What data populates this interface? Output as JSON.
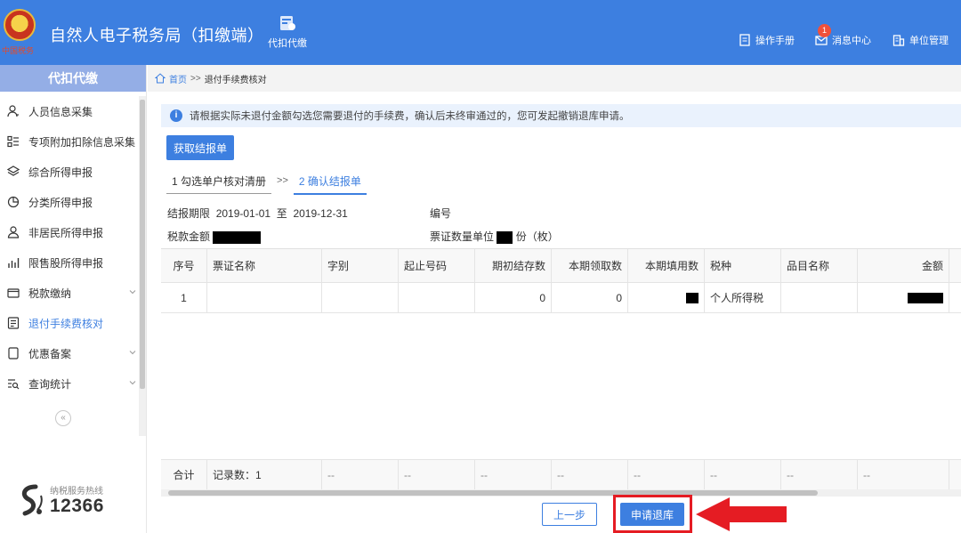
{
  "header": {
    "emblem_text": "中国税务",
    "app_title": "自然人电子税务局（扣缴端）",
    "tab_label": "代扣代缴",
    "manual": "操作手册",
    "messages": "消息中心",
    "messages_badge": "1",
    "unit_mgmt": "单位管理"
  },
  "sidebar": {
    "title": "代扣代缴",
    "items": [
      {
        "label": "人员信息采集",
        "icon": "person-icon"
      },
      {
        "label": "专项附加扣除信息采集",
        "icon": "list-icon"
      },
      {
        "label": "综合所得申报",
        "icon": "layers-icon"
      },
      {
        "label": "分类所得申报",
        "icon": "pie-icon"
      },
      {
        "label": "非居民所得申报",
        "icon": "user-outline-icon"
      },
      {
        "label": "限售股所得申报",
        "icon": "bar-chart-icon"
      },
      {
        "label": "税款缴纳",
        "icon": "wallet-icon"
      },
      {
        "label": "退付手续费核对",
        "icon": "document-icon"
      },
      {
        "label": "优惠备案",
        "icon": "file-icon"
      },
      {
        "label": "查询统计",
        "icon": "search-list-icon"
      }
    ],
    "collapse": "«",
    "hotline_label": "纳税服务热线",
    "hotline_number": "12366"
  },
  "breadcrumb": {
    "home": "首页",
    "sep": ">>",
    "current": "退付手续费核对"
  },
  "notice": "请根据实际未退付金额勾选您需要退付的手续费，确认后未终审通过的，您可发起撤销退库申请。",
  "fetch_button": "获取结报单",
  "steps": {
    "step1": "1 勾选单户核对清册",
    "sep": ">>",
    "step2": "2 确认结报单"
  },
  "info": {
    "period_label": "结报期限",
    "period_start": "2019-01-01",
    "period_to": "至",
    "period_end": "2019-12-31",
    "number_label": "编号",
    "amount_label": "税款金额",
    "unit_label": "票证数量单位",
    "unit_value": "份（枚）"
  },
  "table": {
    "headers": [
      "序号",
      "票证名称",
      "字别",
      "起止号码",
      "期初结存数",
      "本期领取数",
      "本期填用数",
      "税种",
      "品目名称",
      "金额"
    ],
    "rows": [
      [
        "1",
        "",
        "",
        "",
        "0",
        "0",
        "",
        "个人所得税",
        "",
        ""
      ]
    ],
    "footer": {
      "total_label": "合计",
      "record_count": "记录数：1",
      "dash": "--"
    }
  },
  "buttons": {
    "prev": "上一步",
    "submit": "申请退库"
  },
  "colors": {
    "primary": "#3d7fe0",
    "highlight": "#e51c23"
  }
}
